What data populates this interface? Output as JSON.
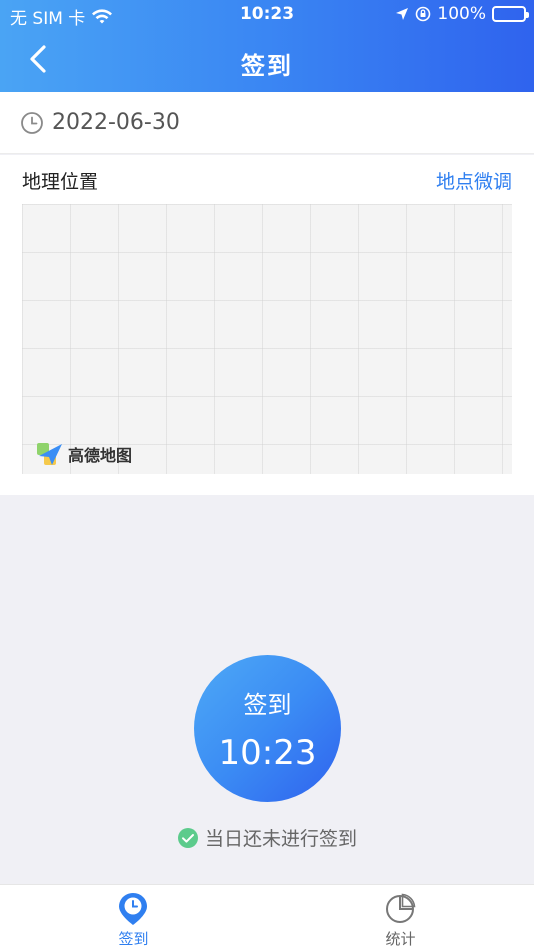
{
  "status_bar": {
    "carrier": "无 SIM 卡",
    "time": "10:23",
    "battery": "100%"
  },
  "nav": {
    "title": "签到"
  },
  "date": "2022-06-30",
  "location": {
    "label": "地理位置",
    "adjust_link": "地点微调",
    "map_brand": "高德地图"
  },
  "checkin": {
    "label": "签到",
    "time": "10:23",
    "status": "当日还未进行签到"
  },
  "tabs": [
    {
      "label": "签到",
      "active": true
    },
    {
      "label": "统计",
      "active": false
    }
  ],
  "colors": {
    "accent": "#2f7ff0",
    "success": "#5ccb8c"
  }
}
